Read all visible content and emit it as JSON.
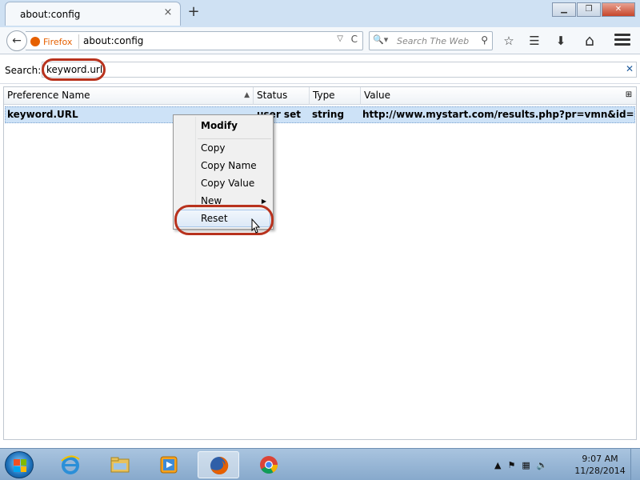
{
  "window": {
    "tab_title": "about:config",
    "tab_close": "×",
    "new_tab": "+",
    "minimize": "▁",
    "maximize": "❐",
    "close": "✕"
  },
  "navbar": {
    "back": "←",
    "identity_label": "Firefox",
    "url": "about:config",
    "url_dropdown": "▽",
    "reload": "C",
    "search_engine": "🔍▾",
    "search_placeholder": "Search The Web",
    "search_go": "⚲",
    "icons": [
      "star-icon",
      "reading-list-icon",
      "download-icon",
      "home-icon",
      "menu-icon"
    ],
    "bookmark": "☆",
    "reading_list": "☰",
    "downloads": "⬇",
    "home": "⌂"
  },
  "config_search": {
    "label": "Search:",
    "value": "keyword.url",
    "clear": "✕"
  },
  "table": {
    "columns": [
      "Preference Name",
      "Status",
      "Type",
      "Value"
    ],
    "sort_indicator": "▲",
    "column_picker": "⊞",
    "rows": [
      {
        "name": "keyword.URL",
        "status": "user set",
        "type": "string",
        "value": "http://www.mystart.com/results.php?pr=vmn&id=mystart..."
      }
    ]
  },
  "context_menu": {
    "items": [
      "Modify",
      "Copy",
      "Copy Name",
      "Copy Value",
      "New",
      "Reset"
    ],
    "submenu_arrow": "▶"
  },
  "taskbar": {
    "apps": [
      "internet-explorer",
      "file-explorer",
      "media-player",
      "firefox",
      "chrome"
    ],
    "active_app": "firefox",
    "tray_expand": "▲",
    "time": "9:07 AM",
    "date": "11/28/2014"
  },
  "colors": {
    "highlight_oval": "#b8321d",
    "selected_row": "#cde2f7",
    "firefox_orange": "#e66000"
  }
}
